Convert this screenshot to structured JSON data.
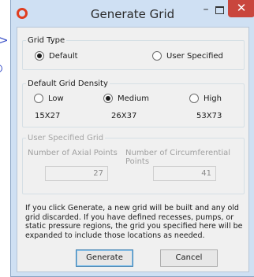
{
  "window": {
    "title": "Generate Grid"
  },
  "grid_type": {
    "legend": "Grid Type",
    "options": [
      {
        "label": "Default",
        "selected": true
      },
      {
        "label": "User Specified",
        "selected": false
      }
    ]
  },
  "density": {
    "legend": "Default Grid Density",
    "options": [
      {
        "label": "Low",
        "size": "15X27",
        "selected": false
      },
      {
        "label": "Medium",
        "size": "26X37",
        "selected": true
      },
      {
        "label": "High",
        "size": "53X73",
        "selected": false
      }
    ]
  },
  "user_grid": {
    "legend": "User Specified Grid",
    "axial_label": "Number of Axial Points",
    "axial_value": "27",
    "circ_label": "Number of Circumferential Points",
    "circ_value": "41"
  },
  "info_text": "If you click Generate, a new grid will be built and any old grid discarded. If you have defined recesses, pumps, or static pressure regions, the grid you specified here will be expanded to include those locations as needed.",
  "buttons": {
    "generate": "Generate",
    "cancel": "Cancel"
  },
  "colors": {
    "close_button": "#c9463d",
    "app_icon": "#e03d1f",
    "titlebar": "#cfe0f3"
  }
}
